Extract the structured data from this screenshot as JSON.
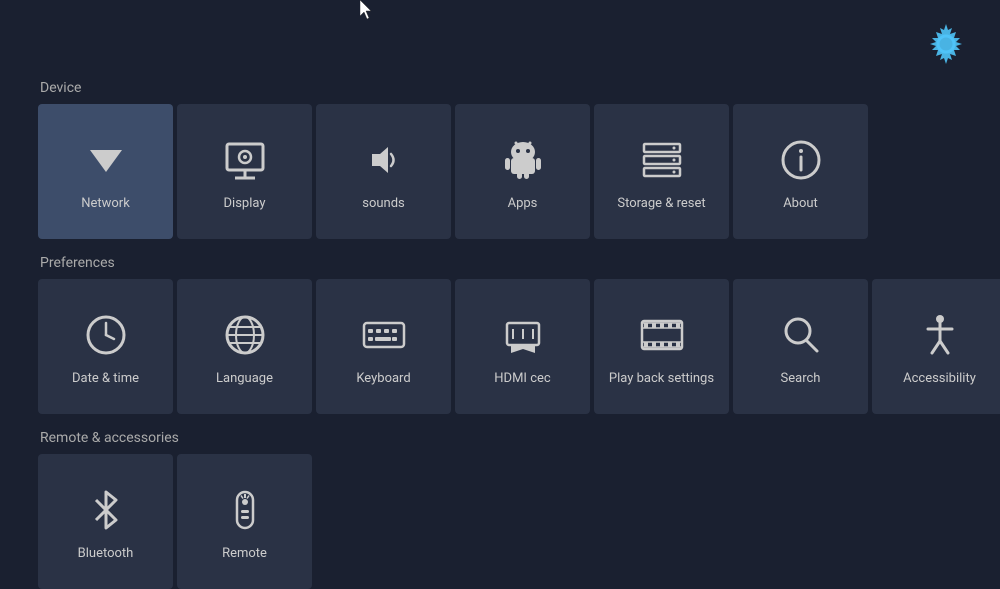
{
  "cursor": {
    "visible": true
  },
  "settings_icon": {
    "label": "Settings"
  },
  "sections": [
    {
      "id": "device",
      "label": "Device",
      "tiles": [
        {
          "id": "network",
          "label": "Network",
          "icon": "wifi",
          "active": true
        },
        {
          "id": "display",
          "label": "Display",
          "icon": "display",
          "active": false
        },
        {
          "id": "sounds",
          "label": "sounds",
          "icon": "volume",
          "active": false
        },
        {
          "id": "apps",
          "label": "Apps",
          "icon": "apps",
          "active": false
        },
        {
          "id": "storage-reset",
          "label": "Storage & reset",
          "icon": "storage",
          "active": false
        },
        {
          "id": "about",
          "label": "About",
          "icon": "info",
          "active": false
        }
      ]
    },
    {
      "id": "preferences",
      "label": "Preferences",
      "tiles": [
        {
          "id": "date-time",
          "label": "Date & time",
          "icon": "clock",
          "active": false
        },
        {
          "id": "language",
          "label": "Language",
          "icon": "globe",
          "active": false
        },
        {
          "id": "keyboard",
          "label": "Keyboard",
          "icon": "keyboard",
          "active": false
        },
        {
          "id": "hdmi-cec",
          "label": "HDMI cec",
          "icon": "hdmi",
          "active": false
        },
        {
          "id": "playback-settings",
          "label": "Play back settings",
          "icon": "film",
          "active": false
        },
        {
          "id": "search",
          "label": "Search",
          "icon": "search",
          "active": false
        },
        {
          "id": "accessibility",
          "label": "Accessibility",
          "icon": "accessibility",
          "active": false
        }
      ]
    },
    {
      "id": "remote-accessories",
      "label": "Remote & accessories",
      "tiles": [
        {
          "id": "bluetooth",
          "label": "Bluetooth",
          "icon": "bluetooth",
          "active": false
        },
        {
          "id": "remote",
          "label": "Remote",
          "icon": "remote",
          "active": false
        }
      ]
    }
  ]
}
